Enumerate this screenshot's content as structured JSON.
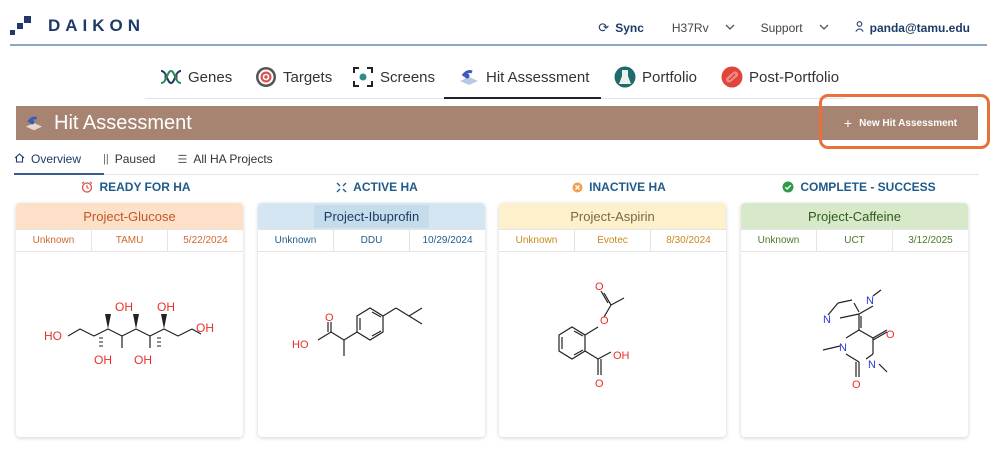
{
  "brand": {
    "name": "DAIKON"
  },
  "topbar": {
    "sync_label": "Sync",
    "strain": "H37Rv",
    "support": "Support",
    "user": "panda@tamu.edu"
  },
  "nav": {
    "tabs": [
      {
        "label": "Genes",
        "icon": "dna-icon"
      },
      {
        "label": "Targets",
        "icon": "target-icon"
      },
      {
        "label": "Screens",
        "icon": "screen-icon"
      },
      {
        "label": "Hit Assessment",
        "icon": "hit-assessment-icon",
        "active": true
      },
      {
        "label": "Portfolio",
        "icon": "flask-icon"
      },
      {
        "label": "Post-Portfolio",
        "icon": "pill-icon"
      }
    ]
  },
  "page": {
    "title": "Hit Assessment",
    "new_button": "New Hit Assessment"
  },
  "subtabs": [
    {
      "label": "Overview",
      "active": true
    },
    {
      "label": "Paused"
    },
    {
      "label": "All HA Projects"
    }
  ],
  "columns": [
    {
      "header": "READY FOR HA",
      "card": {
        "title": "Project-Glucose",
        "meta": [
          "Unknown",
          "TAMU",
          "5/22/2024"
        ]
      }
    },
    {
      "header": "ACTIVE HA",
      "card": {
        "title": "Project-Ibuprofin",
        "meta": [
          "Unknown",
          "DDU",
          "10/29/2024"
        ]
      }
    },
    {
      "header": "INACTIVE HA",
      "card": {
        "title": "Project-Aspirin",
        "meta": [
          "Unknown",
          "Evotec",
          "8/30/2024"
        ]
      }
    },
    {
      "header": "COMPLETE - SUCCESS",
      "card": {
        "title": "Project-Caffeine",
        "meta": [
          "Unknown",
          "UCT",
          "3/12/2025"
        ]
      }
    }
  ],
  "structures": {
    "glucose": {
      "labels": [
        "HO",
        "OH",
        "OH",
        "OH",
        "OH",
        "OH"
      ]
    },
    "ibuprofen": {
      "labels": [
        "O",
        "HO"
      ]
    },
    "aspirin": {
      "labels": [
        "O",
        "O",
        "OH",
        "O"
      ]
    },
    "caffeine": {
      "labels": [
        "N",
        "N",
        "N",
        "N",
        "O",
        "O"
      ]
    }
  },
  "colors": {
    "brand": "#1f3a68",
    "banner": "#a78471",
    "highlight": "#e8713a"
  }
}
